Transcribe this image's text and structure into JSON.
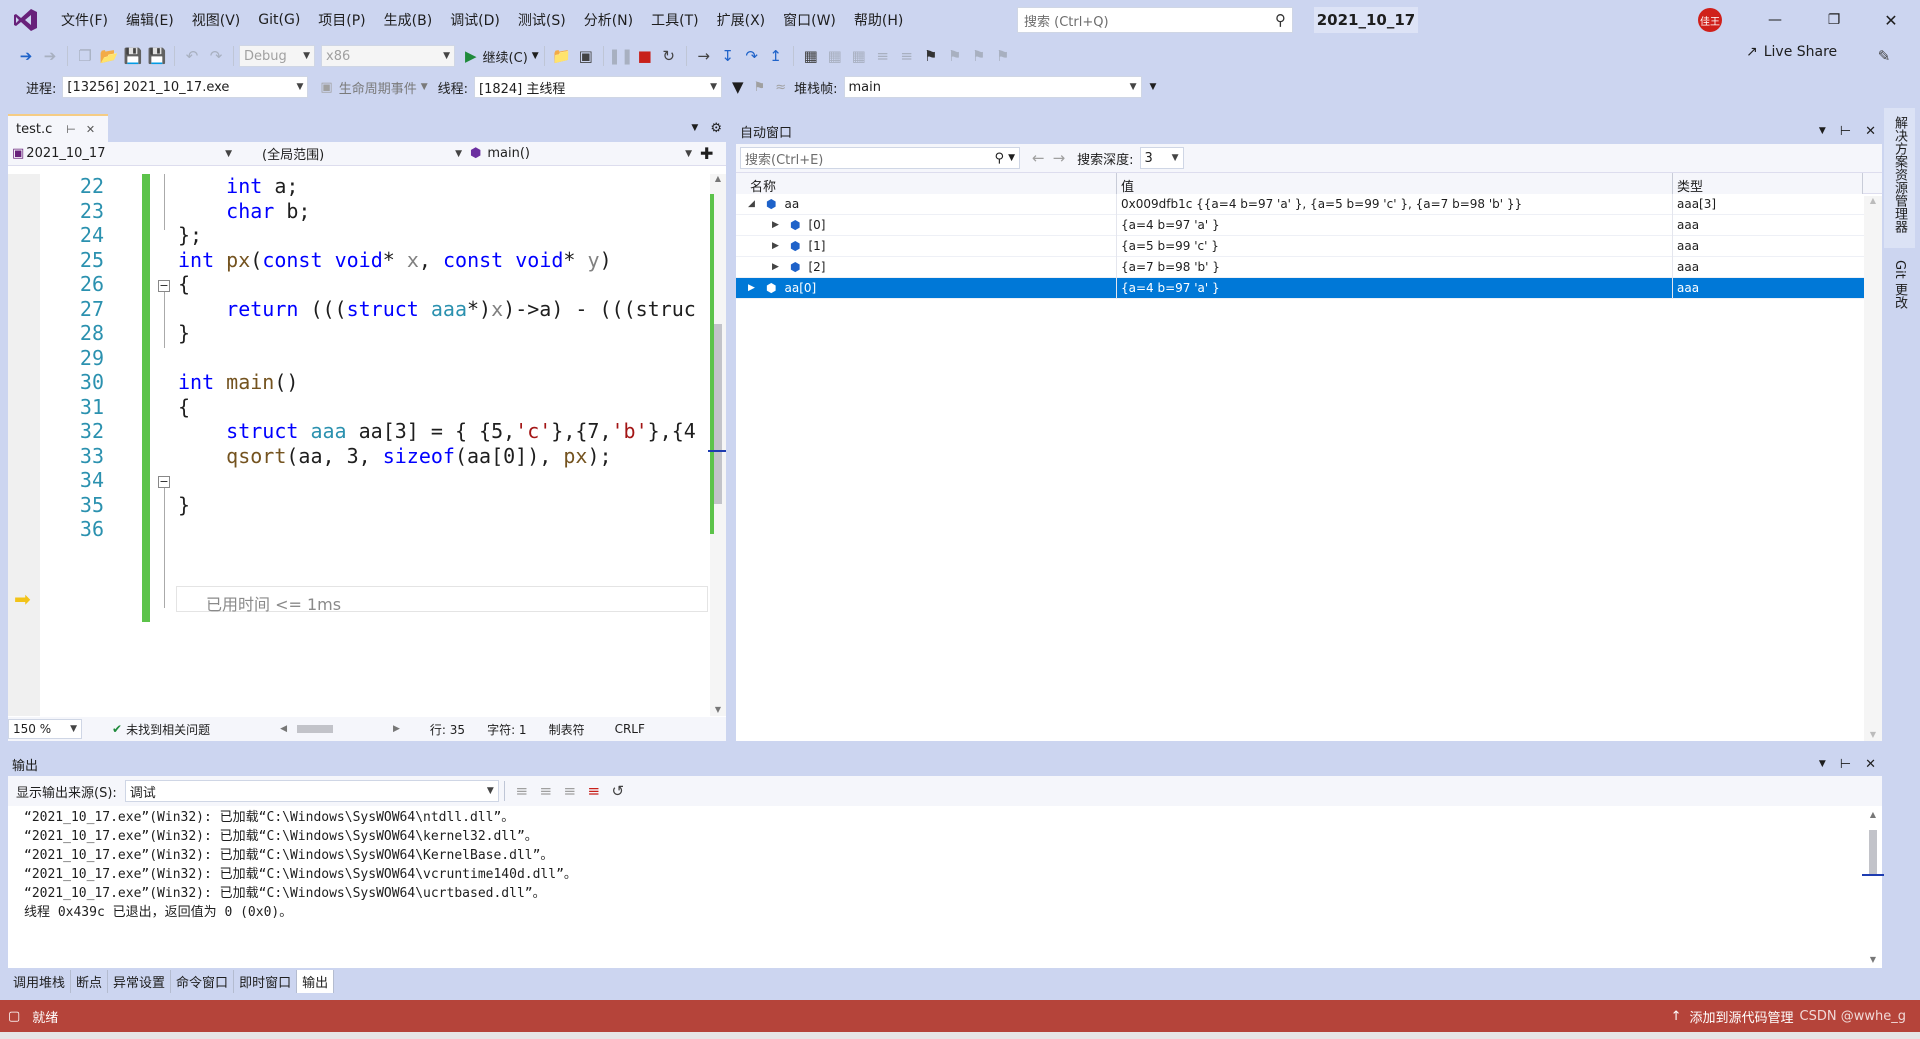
{
  "window": {
    "search_placeholder": "搜索 (Ctrl+Q)",
    "solution_name": "2021_10_17",
    "user_badge": "佳王",
    "live_share": "Live Share"
  },
  "menu": [
    "文件(F)",
    "编辑(E)",
    "视图(V)",
    "Git(G)",
    "项目(P)",
    "生成(B)",
    "调试(D)",
    "测试(S)",
    "分析(N)",
    "工具(T)",
    "扩展(X)",
    "窗口(W)",
    "帮助(H)"
  ],
  "toolbar": {
    "config": "Debug",
    "platform": "x86",
    "continue_label": "继续(C)"
  },
  "debug_bar": {
    "process_label": "进程:",
    "process_value": "[13256] 2021_10_17.exe",
    "lifecycle_label": "生命周期事件",
    "thread_label": "线程:",
    "thread_value": "[1824] 主线程",
    "stack_label": "堆栈帧:",
    "stack_value": "main"
  },
  "editor": {
    "tab_name": "test.c",
    "project_combo": "2021_10_17",
    "scope_combo": "(全局范围)",
    "func_combo": "main()",
    "lines": [
      {
        "n": "22",
        "code": "    int a;"
      },
      {
        "n": "23",
        "code": "    char b;"
      },
      {
        "n": "24",
        "code": "};"
      },
      {
        "n": "25",
        "code": "int px(const void* x, const void* y)"
      },
      {
        "n": "26",
        "code": "{"
      },
      {
        "n": "27",
        "code": "    return (((struct aaa*)x)->a) - (((struc"
      },
      {
        "n": "28",
        "code": "}"
      },
      {
        "n": "29",
        "code": ""
      },
      {
        "n": "30",
        "code": "int main()"
      },
      {
        "n": "31",
        "code": "{"
      },
      {
        "n": "32",
        "code": "    struct aaa aa[3] = { {5,'c'},{7,'b'},{4"
      },
      {
        "n": "33",
        "code": "    qsort(aa, 3, sizeof(aa[0]), px);"
      },
      {
        "n": "34",
        "code": ""
      },
      {
        "n": "35",
        "code": "}"
      },
      {
        "n": "36",
        "code": ""
      }
    ],
    "elapsed": "已用时间 <= 1ms"
  },
  "editor_status": {
    "zoom": "150 %",
    "issues": "未找到相关问题",
    "line": "行: 35",
    "char": "字符: 1",
    "tabs": "制表符",
    "eol": "CRLF"
  },
  "autos": {
    "title": "自动窗口",
    "search_placeholder": "搜索(Ctrl+E)",
    "depth_label": "搜索深度:",
    "depth_value": "3",
    "columns": [
      "名称",
      "值",
      "类型"
    ],
    "rows": [
      {
        "name": "aa",
        "value": "0x009dfb1c {{a=4 b=97 'a' }, {a=5 b=99 'c' }, {a=7 b=98 'b' }}",
        "type": "aaa[3]",
        "level": 0,
        "expanded": true
      },
      {
        "name": "[0]",
        "value": "{a=4 b=97 'a' }",
        "type": "aaa",
        "level": 1,
        "expanded": false
      },
      {
        "name": "[1]",
        "value": "{a=5 b=99 'c' }",
        "type": "aaa",
        "level": 1,
        "expanded": false
      },
      {
        "name": "[2]",
        "value": "{a=7 b=98 'b' }",
        "type": "aaa",
        "level": 1,
        "expanded": false
      },
      {
        "name": "aa[0]",
        "value": "{a=4 b=97 'a' }",
        "type": "aaa",
        "level": 0,
        "expanded": false,
        "selected": true
      }
    ]
  },
  "right_rail": [
    "解决方案资源管理器",
    "Git 更改"
  ],
  "output": {
    "title": "输出",
    "source_label": "显示输出来源(S):",
    "source_value": "调试",
    "lines": [
      "“2021_10_17.exe”(Win32): 已加载“C:\\Windows\\SysWOW64\\ntdll.dll”。",
      "“2021_10_17.exe”(Win32): 已加载“C:\\Windows\\SysWOW64\\kernel32.dll”。",
      "“2021_10_17.exe”(Win32): 已加载“C:\\Windows\\SysWOW64\\KernelBase.dll”。",
      "“2021_10_17.exe”(Win32): 已加载“C:\\Windows\\SysWOW64\\vcruntime140d.dll”。",
      "“2021_10_17.exe”(Win32): 已加载“C:\\Windows\\SysWOW64\\ucrtbased.dll”。",
      "线程 0x439c 已退出，返回值为 0 (0x0)。"
    ]
  },
  "bottom_tabs": [
    "调用堆栈",
    "断点",
    "异常设置",
    "命令窗口",
    "即时窗口",
    "输出"
  ],
  "status": {
    "text": "就绪",
    "source_control": "添加到源代码管理",
    "watermark": "CSDN @wwhe_g"
  },
  "colors": {
    "status_bar": "#b5443a",
    "selection": "#0078d7",
    "accent": "#68217a"
  }
}
